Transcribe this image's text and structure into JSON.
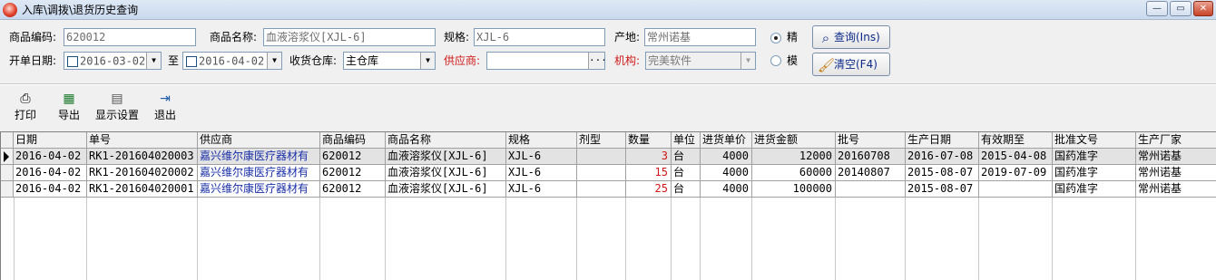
{
  "window": {
    "title": "入库\\调拨\\退货历史查询",
    "min_label": "—",
    "max_label": "▭",
    "close_label": "✕"
  },
  "filters": {
    "code_label": "商品编码:",
    "code_value": "620012",
    "name_label": "商品名称:",
    "name_value": "血液溶浆仪[XJL-6]",
    "spec_label": "规格:",
    "spec_value": "XJL-6",
    "origin_label": "产地:",
    "origin_value": "常州诺基",
    "precise_label": "精",
    "fuzzy_label": "模",
    "date_label": "开单日期:",
    "date_from": "2016-03-02",
    "to_label": "至",
    "date_to": "2016-04-02",
    "warehouse_label": "收货仓库:",
    "warehouse_value": "主仓库",
    "supplier_label": "供应商:",
    "supplier_value": "",
    "supplier_button": "···",
    "org_label": "机构:",
    "org_value": "完美软件",
    "query_button": "查询(Ins)",
    "clear_button": "清空(F4)"
  },
  "toolbar": {
    "print": "打印",
    "export": "导出",
    "display": "显示设置",
    "exit": "退出"
  },
  "icons": {
    "print": "printer-icon",
    "export": "excel-export-icon",
    "display": "display-settings-icon",
    "exit": "exit-door-icon",
    "query": "search-icon",
    "clear": "broom-icon"
  },
  "colors": {
    "required_label": "#d01818",
    "quantity": "#d01818",
    "supplier_text": "#1a2fa8"
  },
  "table": {
    "columns": [
      "日期",
      "单号",
      "供应商",
      "商品编码",
      "商品名称",
      "规格",
      "剂型",
      "数量",
      "单位",
      "进货单价",
      "进货金额",
      "批号",
      "生产日期",
      "有效期至",
      "批准文号",
      "生产厂家"
    ],
    "rows": [
      [
        "2016-04-02",
        "RK1-201604020003",
        "嘉兴维尔康医疗器材有",
        "620012",
        "血液溶浆仪[XJL-6]",
        "XJL-6",
        "",
        "3",
        "台",
        "4000",
        "12000",
        "20160708",
        "2016-07-08",
        "2015-04-08",
        "国药准字",
        "常州诺基"
      ],
      [
        "2016-04-02",
        "RK1-201604020002",
        "嘉兴维尔康医疗器材有",
        "620012",
        "血液溶浆仪[XJL-6]",
        "XJL-6",
        "",
        "15",
        "台",
        "4000",
        "60000",
        "20140807",
        "2015-08-07",
        "2019-07-09",
        "国药准字",
        "常州诺基"
      ],
      [
        "2016-04-02",
        "RK1-201604020001",
        "嘉兴维尔康医疗器材有",
        "620012",
        "血液溶浆仪[XJL-6]",
        "XJL-6",
        "",
        "25",
        "台",
        "4000",
        "100000",
        "",
        "2015-08-07",
        "",
        "国药准字",
        "常州诺基"
      ]
    ]
  }
}
